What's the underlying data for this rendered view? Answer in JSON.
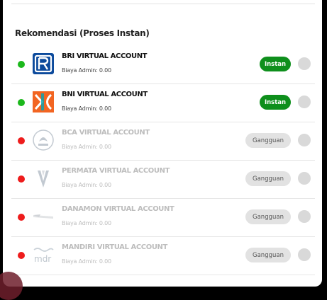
{
  "section": {
    "title": "Rekomendasi (Proses Instan)"
  },
  "colors": {
    "online": "#1cb81c",
    "offline": "#ee1c1c",
    "instant_badge": "#0e8f1c",
    "disrupted_badge": "#e2e2e2"
  },
  "banks": [
    {
      "name": "BRI VIRTUAL ACCOUNT",
      "fee": "Biaya Admin: 0.00",
      "status": "Instan",
      "logo": "bri-logo"
    },
    {
      "name": "BNI VIRTUAL ACCOUNT",
      "fee": "Biaya Admin: 0.00",
      "status": "Instan",
      "logo": "bni-logo"
    },
    {
      "name": "BCA VIRTUAL ACCOUNT",
      "fee": "Biaya Admin: 0.00",
      "status": "Gangguan",
      "logo": "bca-logo"
    },
    {
      "name": "PERMATA VIRTUAL ACCOUNT",
      "fee": "Biaya Admin: 0.00",
      "status": "Gangguan",
      "logo": "permata-logo"
    },
    {
      "name": "DANAMON VIRTUAL ACCOUNT",
      "fee": "Biaya Admin: 0.00",
      "status": "Gangguan",
      "logo": "danamon-logo"
    },
    {
      "name": "MANDIRI VIRTUAL ACCOUNT",
      "fee": "Biaya Admin: 0.00",
      "status": "Gangguan",
      "logo": "mandiri-logo",
      "logo_text": "mdr"
    }
  ]
}
